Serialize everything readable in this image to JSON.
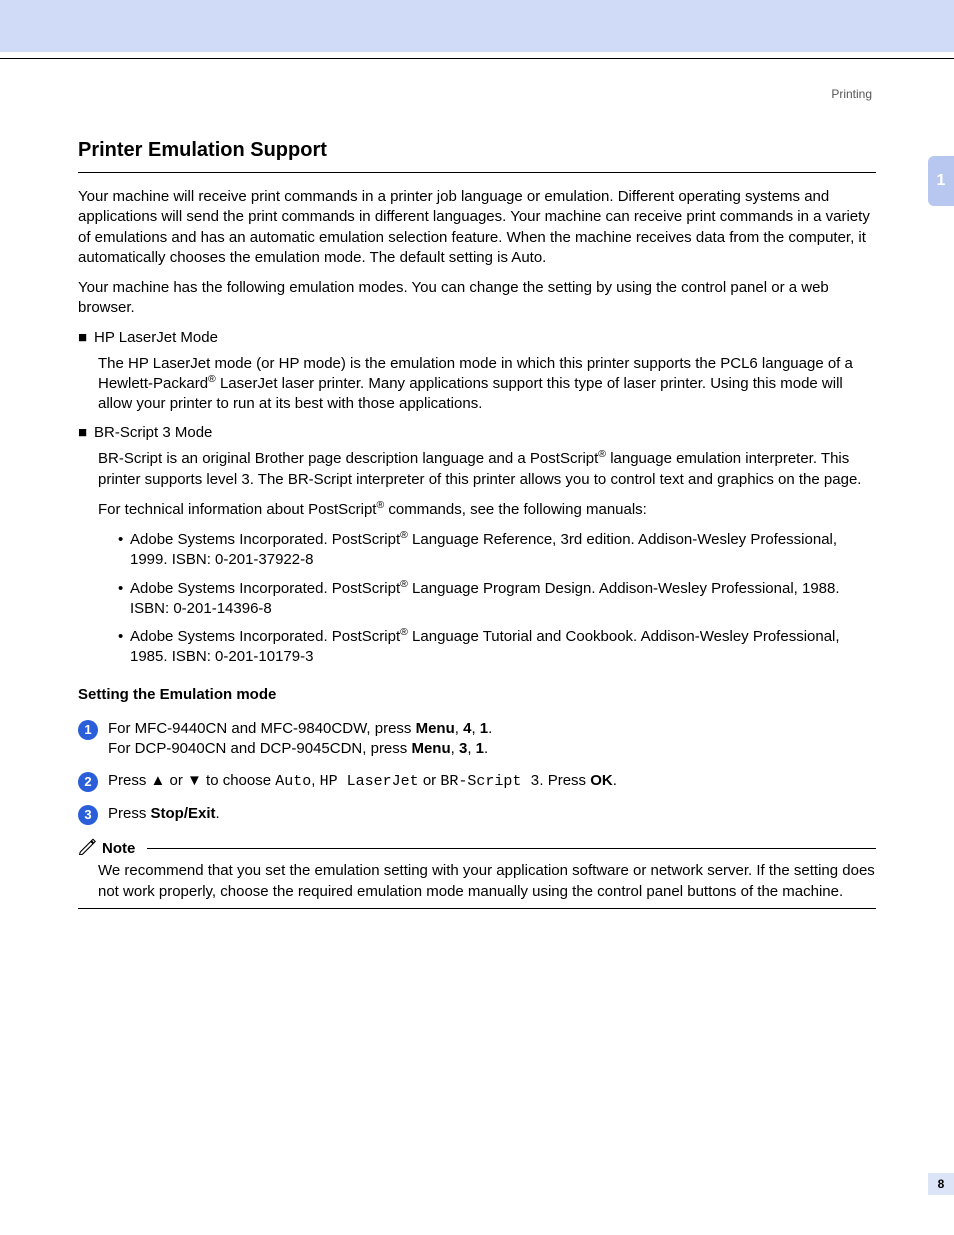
{
  "header_label": "Printing",
  "side_tab": "1",
  "page_number": "8",
  "title": "Printer Emulation Support",
  "intro_p1": "Your machine will receive print commands in a printer job language or emulation. Different operating systems and applications will send the print commands in different languages. Your machine can receive print commands in a variety of emulations and has an automatic emulation selection feature. When the machine receives data from the computer, it automatically chooses the emulation mode. The default setting is Auto.",
  "intro_p2": "Your machine has the following emulation modes. You can change the setting by using the control panel or a web browser.",
  "modes": {
    "hp": {
      "title": "HP LaserJet Mode",
      "body_pre": "The HP LaserJet mode (or HP mode) is the emulation mode in which this printer supports the PCL6 language of a Hewlett-Packard",
      "body_post": " LaserJet laser printer. Many applications support this type of laser printer. Using this mode will allow your printer to run at its best with those applications."
    },
    "br": {
      "title": "BR-Script 3 Mode",
      "body_pre": "BR-Script is an original Brother page description language and a PostScript",
      "body_post": " language emulation interpreter. This printer supports level 3. The BR-Script interpreter of this printer allows you to control text and graphics on the page.",
      "tech_pre": "For technical information about PostScript",
      "tech_post": " commands, see the following manuals:"
    }
  },
  "references": [
    {
      "pre": "Adobe Systems Incorporated. PostScript",
      "post": " Language Reference, 3rd edition. Addison-Wesley Professional, 1999. ISBN: 0-201-37922-8"
    },
    {
      "pre": "Adobe Systems Incorporated. PostScript",
      "post": " Language Program Design. Addison-Wesley Professional, 1988. ISBN: 0-201-14396-8"
    },
    {
      "pre": "Adobe Systems Incorporated. PostScript",
      "post": " Language Tutorial and Cookbook. Addison-Wesley Professional, 1985. ISBN: 0-201-10179-3"
    }
  ],
  "subheading": "Setting the Emulation mode",
  "steps": {
    "s1": {
      "line1_pre": "For MFC-9440CN and MFC-9840CDW, press ",
      "menu": "Menu",
      "c1": ", ",
      "n4": "4",
      "c2": ", ",
      "n1": "1",
      "dot": ".",
      "line2_pre": "For DCP-9040CN and DCP-9045CDN, press ",
      "n3": "3"
    },
    "s2": {
      "pre": "Press ▲ or ▼ to choose ",
      "opt_auto": "Auto",
      "c1": ", ",
      "opt_hp": "HP LaserJet",
      "or": " or ",
      "opt_br": "BR-Script 3",
      "post": ". Press ",
      "ok": "OK",
      "dot": "."
    },
    "s3": {
      "pre": "Press ",
      "stop": "Stop/Exit",
      "dot": "."
    }
  },
  "note": {
    "label": "Note",
    "body": "We recommend that you set the emulation setting with your application software or network server. If the setting does not work properly, choose the required emulation mode manually using the control panel buttons of the machine."
  }
}
